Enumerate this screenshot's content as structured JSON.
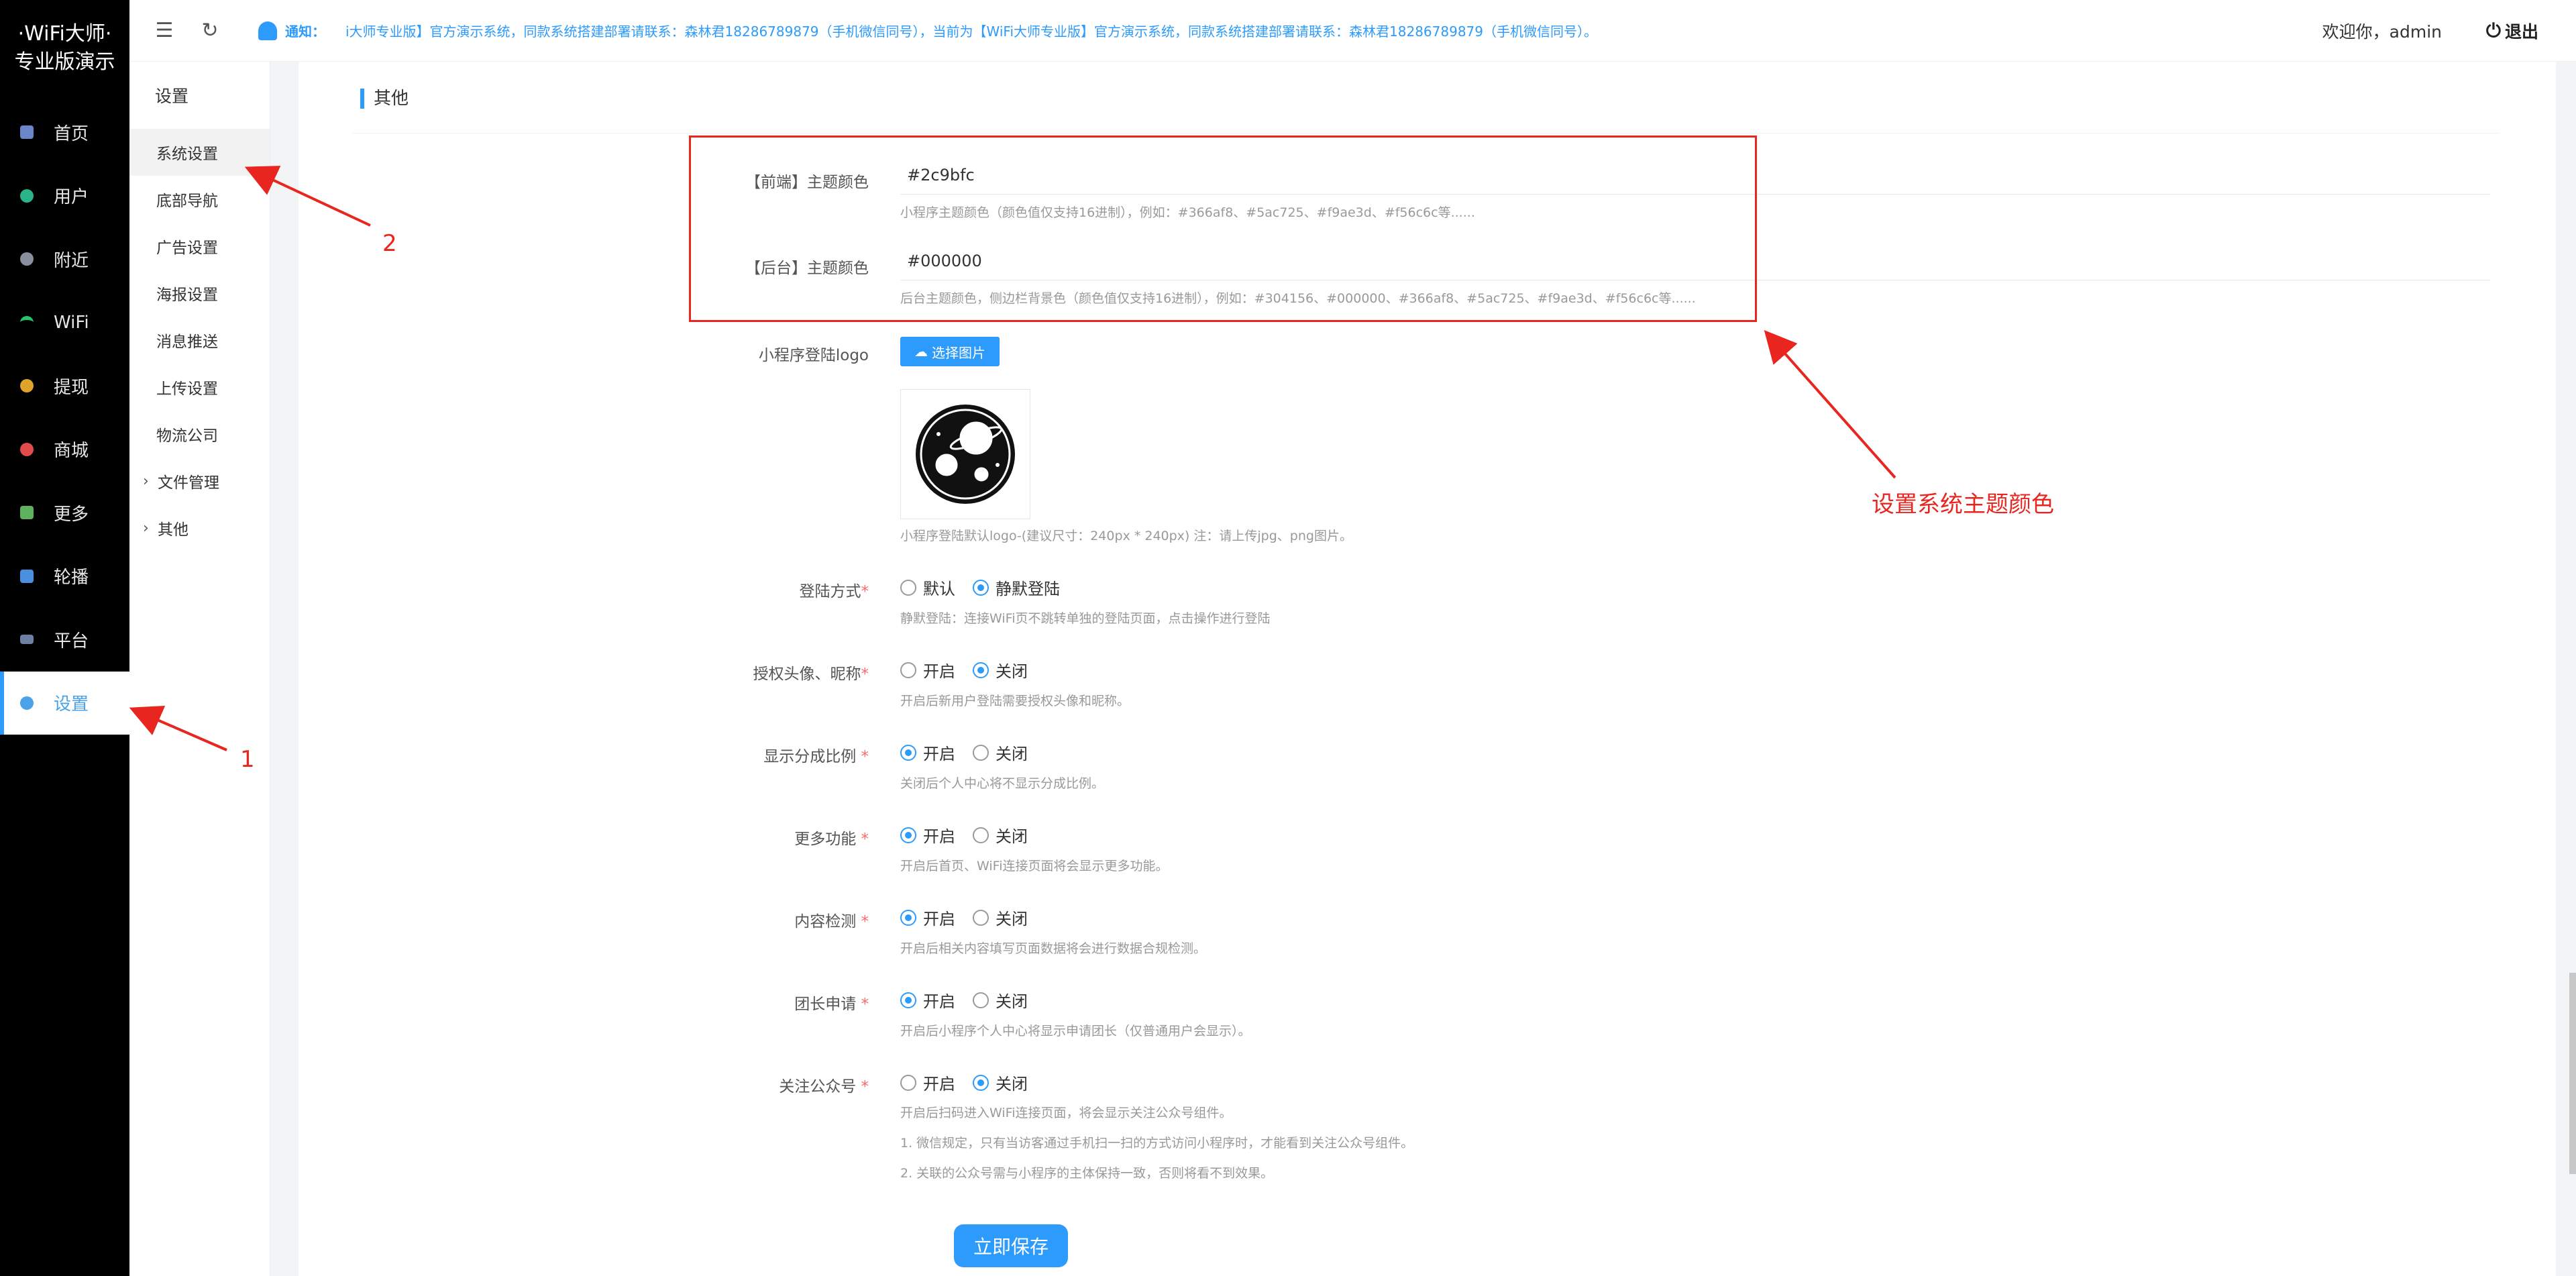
{
  "brand": {
    "line1": "·WiFi大师·",
    "line2": "专业版演示"
  },
  "sidebar": {
    "items": [
      {
        "label": "首页",
        "icon": "home-icon",
        "color": "#6a86c8"
      },
      {
        "label": "用户",
        "icon": "user-icon",
        "color": "#2bb38a"
      },
      {
        "label": "附近",
        "icon": "location-icon",
        "color": "#8a8fa0"
      },
      {
        "label": "WiFi",
        "icon": "wifi-icon",
        "color": "#25c46b"
      },
      {
        "label": "提现",
        "icon": "coin-icon",
        "color": "#e0a429"
      },
      {
        "label": "商城",
        "icon": "shop-icon",
        "color": "#e24b4b"
      },
      {
        "label": "更多",
        "icon": "grid-icon",
        "color": "#5fb05f"
      },
      {
        "label": "轮播",
        "icon": "carousel-icon",
        "color": "#4a8fe0"
      },
      {
        "label": "平台",
        "icon": "monitor-icon",
        "color": "#6d7fa2"
      },
      {
        "label": "设置",
        "icon": "gear-icon",
        "color": "#4aa3e6",
        "active": true
      }
    ]
  },
  "subnav": {
    "title": "设置",
    "items": [
      "系统设置",
      "底部导航",
      "广告设置",
      "海报设置",
      "消息推送",
      "上传设置",
      "物流公司",
      "文件管理",
      "其他"
    ]
  },
  "topbar": {
    "notice_label": "通知：",
    "notice_text": "i大师专业版】官方演示系统，同款系统搭建部署请联系：森林君18286789879（手机微信同号），当前为【WiFi大师专业版】官方演示系统，同款系统搭建部署请联系：森林君18286789879（手机微信同号）。",
    "welcome": "欢迎你，admin",
    "logout": "退出"
  },
  "section": {
    "title": "其他"
  },
  "theme": {
    "front_label": "【前端】主题颜色",
    "front_value": "#2c9bfc",
    "front_help": "小程序主题颜色（颜色值仅支持16进制），例如：#366af8、#5ac725、#f9ae3d、#f56c6c等......",
    "back_label": "【后台】主题颜色",
    "back_value": "#000000",
    "back_help": "后台主题颜色，侧边栏背景色（颜色值仅支持16进制），例如：#304156、#000000、#366af8、#5ac725、#f9ae3d、#f56c6c等......"
  },
  "logo": {
    "label": "小程序登陆logo",
    "button": "选择图片",
    "help": "小程序登陆默认logo-(建议尺寸：240px * 240px) 注：请上传jpg、png图片。"
  },
  "options": [
    {
      "label": "登陆方式",
      "a": "默认",
      "b": "静默登陆",
      "selected": "b",
      "help": "静默登陆：连接WiFi页不跳转单独的登陆页面，点击操作进行登陆"
    },
    {
      "label": "授权头像、昵称",
      "a": "开启",
      "b": "关闭",
      "selected": "b",
      "help": "开启后新用户登陆需要授权头像和昵称。"
    },
    {
      "label": "显示分成比例",
      "a": "开启",
      "b": "关闭",
      "selected": "a",
      "help": "关闭后个人中心将不显示分成比例。"
    },
    {
      "label": "更多功能",
      "a": "开启",
      "b": "关闭",
      "selected": "a",
      "help": "开启后首页、WiFi连接页面将会显示更多功能。"
    },
    {
      "label": "内容检测",
      "a": "开启",
      "b": "关闭",
      "selected": "a",
      "help": "开启后相关内容填写页面数据将会进行数据合规检测。"
    },
    {
      "label": "团长申请",
      "a": "开启",
      "b": "关闭",
      "selected": "a",
      "help": "开启后小程序个人中心将显示申请团长（仅普通用户会显示）。"
    },
    {
      "label": "关注公众号",
      "a": "开启",
      "b": "关闭",
      "selected": "b",
      "help": "开启后扫码进入WiFi连接页面，将会显示关注公众号组件。"
    }
  ],
  "follow_notes": [
    "1. 微信规定，只有当访客通过手机扫一扫的方式访问小程序时，才能看到关注公众号组件。",
    "2. 关联的公众号需与小程序的主体保持一致，否则将看不到效果。"
  ],
  "save_label": "立即保存",
  "annotations": {
    "one": "1",
    "two": "2",
    "theme_note": "设置系统主题颜色",
    "color": "#e8261f"
  }
}
